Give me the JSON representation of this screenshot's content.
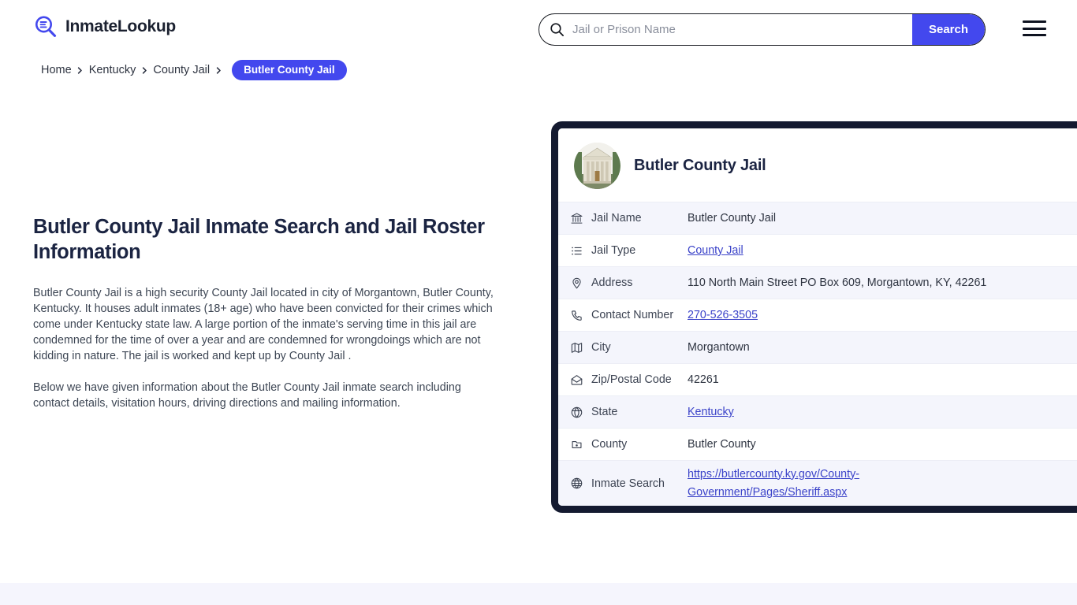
{
  "header": {
    "brand_name": "InmateLookup",
    "brand_icon": "magnifier-list-logo-icon",
    "search": {
      "placeholder": "Jail or Prison Name",
      "value": "",
      "button_label": "Search",
      "icon": "search-icon"
    },
    "menu_icon": "hamburger-menu-icon"
  },
  "breadcrumb": {
    "items": [
      {
        "label": "Home"
      },
      {
        "label": "Kentucky"
      },
      {
        "label": "County Jail"
      }
    ],
    "separator": "chevron-right-icon",
    "current": "Butler County Jail"
  },
  "main": {
    "title": "Butler County Jail Inmate Search and Jail Roster Information",
    "paragraph_1": "Butler County Jail is a high security County Jail located in city of Morgantown, Butler County, Kentucky. It houses adult inmates (18+ age) who have been convicted for their crimes which come under Kentucky state law. A large portion of the inmate's serving time in this jail are condemned for the time of over a year and are condemned for wrongdoings which are not kidding in nature. The jail is worked and kept up by County Jail .",
    "paragraph_2": "Below we have given information about the Butler County Jail inmate search including contact details, visitation hours, driving directions and mailing information."
  },
  "card": {
    "avatar_icon": "jail-building-photo",
    "title": "Butler County Jail",
    "rows": [
      {
        "icon": "bank-building-icon",
        "label": "Jail Name",
        "value": "Butler County Jail",
        "is_link": false
      },
      {
        "icon": "list-icon",
        "label": "Jail Type",
        "value": "County Jail",
        "is_link": true
      },
      {
        "icon": "map-pin-icon",
        "label": "Address",
        "value": "110 North Main Street PO Box 609, Morgantown, KY, 42261",
        "is_link": false
      },
      {
        "icon": "phone-icon",
        "label": "Contact Number",
        "value": "270-526-3505",
        "is_link": true
      },
      {
        "icon": "map-icon",
        "label": "City",
        "value": "Morgantown",
        "is_link": false
      },
      {
        "icon": "envelope-icon",
        "label": "Zip/Postal Code",
        "value": "42261",
        "is_link": false
      },
      {
        "icon": "globe-compass-icon",
        "label": "State",
        "value": "Kentucky",
        "is_link": true
      },
      {
        "icon": "shield-dot-icon",
        "label": "County",
        "value": "Butler County",
        "is_link": false
      },
      {
        "icon": "globe-icon",
        "label": "Inmate Search",
        "value": "https://butlercounty.ky.gov/County-Government/Pages/Sheriff.aspx",
        "is_link": true
      }
    ]
  },
  "colors": {
    "accent_blue": "#4348ee",
    "link_blue": "#3b43c9",
    "card_border_navy": "#141a30",
    "row_alt_background": "#f4f5fc",
    "heading_navy": "#1b2442",
    "bottom_band": "#f5f5fd"
  }
}
